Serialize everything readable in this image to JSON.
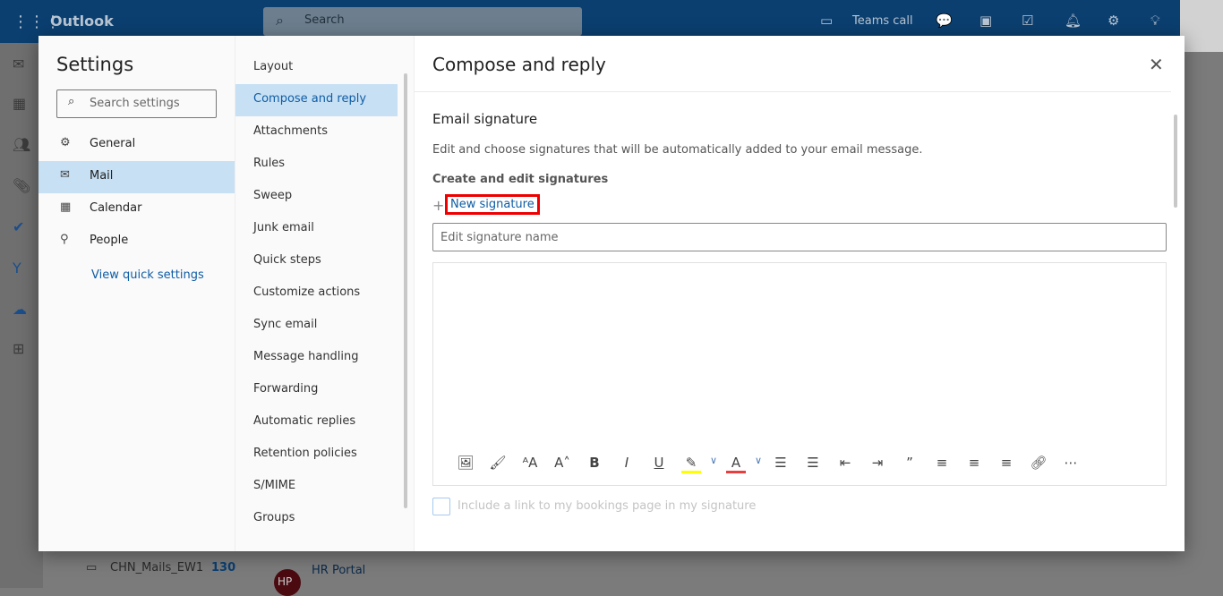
{
  "topbar": {
    "app": "Outlook",
    "search_placeholder": "Search",
    "teams_call": "Teams call"
  },
  "background": {
    "folder": "CHN_Mails_EW1",
    "folder_count": "130",
    "sender": "HR Portal",
    "avatar": "HP"
  },
  "settings": {
    "title": "Settings",
    "search_placeholder": "Search settings",
    "categories": [
      {
        "label": "General",
        "icon": "gear-icon"
      },
      {
        "label": "Mail",
        "icon": "mail-icon"
      },
      {
        "label": "Calendar",
        "icon": "calendar-icon"
      },
      {
        "label": "People",
        "icon": "people-icon"
      }
    ],
    "selected_category": "Mail",
    "quick_settings": "View quick settings",
    "mail_items": [
      "Layout",
      "Compose and reply",
      "Attachments",
      "Rules",
      "Sweep",
      "Junk email",
      "Quick steps",
      "Customize actions",
      "Sync email",
      "Message handling",
      "Forwarding",
      "Automatic replies",
      "Retention policies",
      "S/MIME",
      "Groups"
    ],
    "selected_item": "Compose and reply"
  },
  "pane": {
    "title": "Compose and reply",
    "section": "Email signature",
    "description": "Edit and choose signatures that will be automatically added to your email message.",
    "subheading": "Create and edit signatures",
    "new_signature": "New signature",
    "name_placeholder": "Edit signature name",
    "bookings_label": "Include a link to my bookings page in my signature",
    "highlight_color": "#ffff00",
    "font_color": "#e83e3e"
  }
}
